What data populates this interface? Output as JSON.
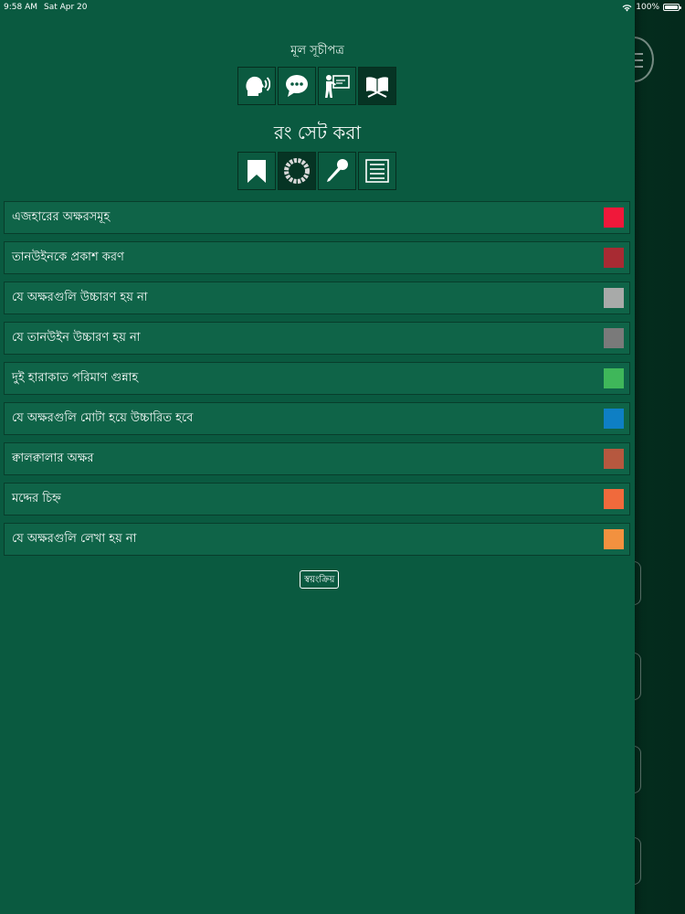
{
  "status_bar": {
    "time": "9:58 AM",
    "date": "Sat Apr 20",
    "battery": "100%",
    "icons": [
      "wifi-icon",
      "battery-icon"
    ]
  },
  "menu": {
    "title": "মূল সূচীপত্র",
    "icons": [
      "speaking-head-icon",
      "chat-bubble-icon",
      "teacher-board-icon",
      "quran-book-icon"
    ],
    "active_index": 3
  },
  "color_settings": {
    "title": "রং সেট করা",
    "icons": [
      "bookmark-icon",
      "color-wheel-icon",
      "microphone-icon",
      "list-icon"
    ],
    "active_index": 1,
    "items": [
      {
        "label": "এজহারের অক্ষরসমূহ",
        "color": "#f0183a"
      },
      {
        "label": "তানউইনকে প্রকাশ করণ",
        "color": "#a82b33"
      },
      {
        "label": "যে অক্ষরগুলি উচ্চারণ হয় না",
        "color": "#a8aaa9"
      },
      {
        "label": "যে তানউইন উচ্চারণ হয় না",
        "color": "#7a7a7a"
      },
      {
        "label": "দুই হারাকাত পরিমাণ গুন্নাহ",
        "color": "#3fb75a"
      },
      {
        "label": "যে অক্ষরগুলি মোটা হয়ে উচ্চারিত হবে",
        "color": "#0e7fc4"
      },
      {
        "label": "ক্বালক্বালার অক্ষর",
        "color": "#b6583f"
      },
      {
        "label": "মদ্দের চিহ্ন",
        "color": "#f06a3c"
      },
      {
        "label": "যে অক্ষরগুলি লেখা হয় না",
        "color": "#f2913f"
      }
    ]
  },
  "auto_button": {
    "label": "স্বয়ংক্রিয়"
  }
}
